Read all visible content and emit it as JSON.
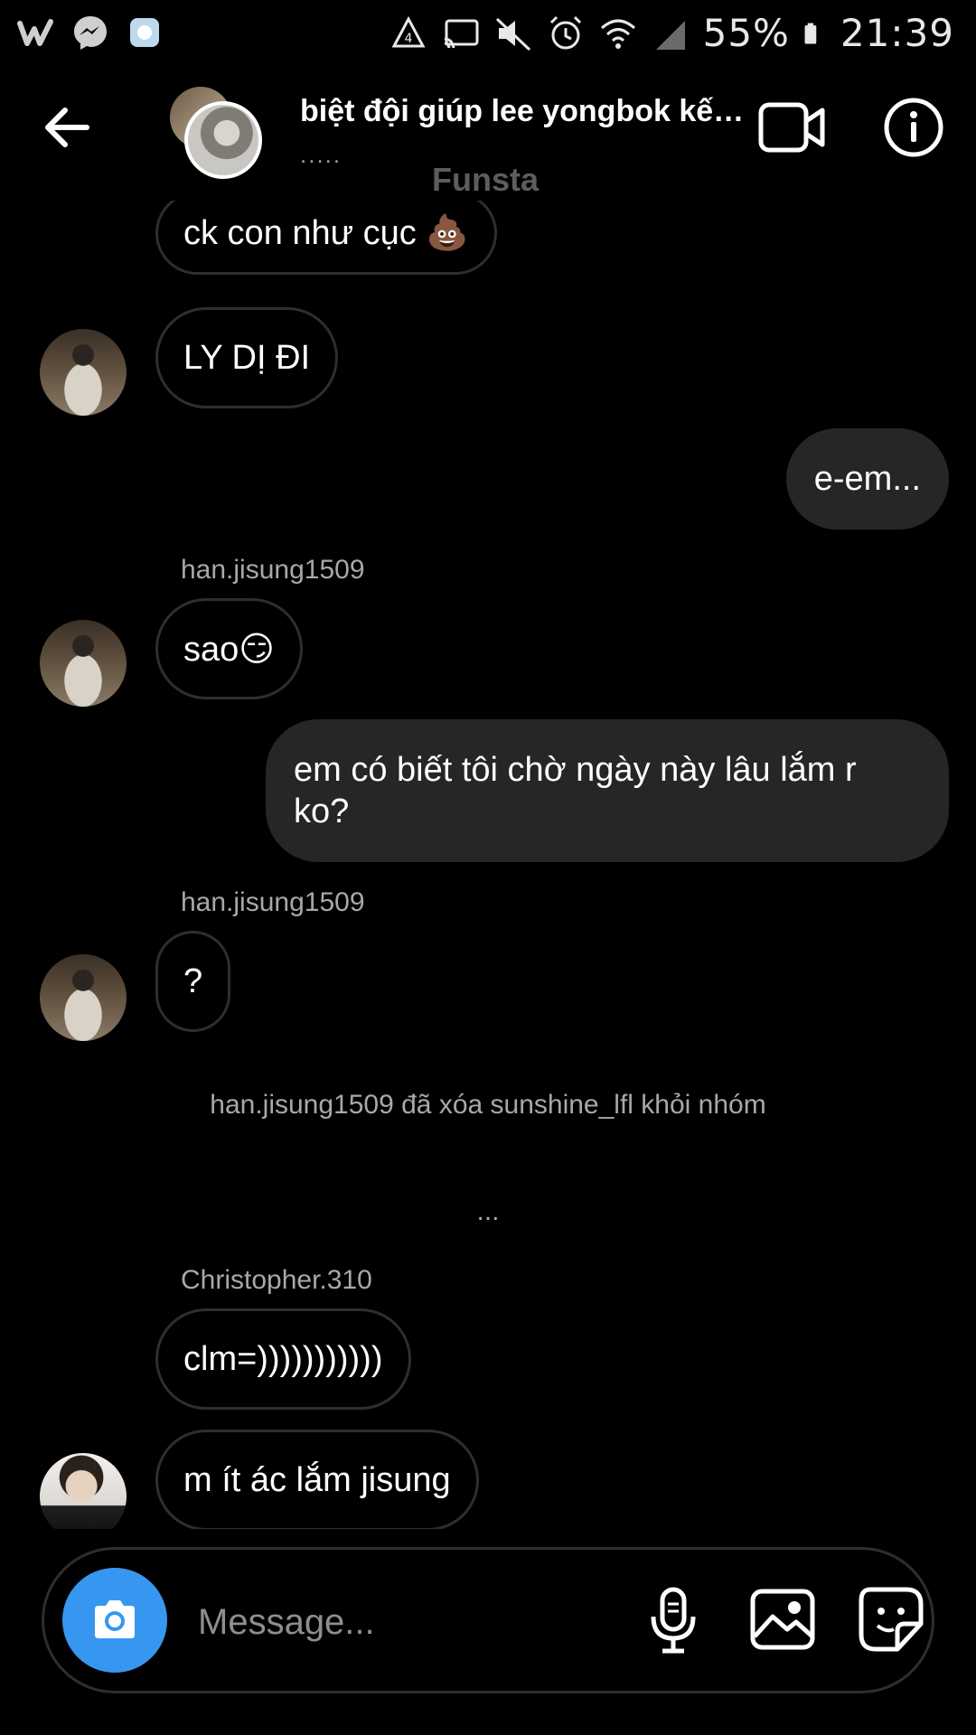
{
  "status_bar": {
    "battery": "55%",
    "time": "21:39",
    "left_icons": [
      "wattpad-icon",
      "messenger-icon",
      "app-icon"
    ],
    "right_icons": [
      "data-saver-icon",
      "cast-icon",
      "mute-icon",
      "alarm-icon",
      "wifi-icon",
      "signal-icon",
      "battery-icon"
    ]
  },
  "header": {
    "title": "biệt đội giúp lee yongbok kết ...",
    "subtitle": ".....",
    "funsta_label": "Funsta"
  },
  "messages": [
    {
      "from": "other",
      "text": "ck con như cục 💩"
    },
    {
      "from": "other",
      "text": "LY DỊ ĐI"
    },
    {
      "from": "me",
      "text": "e-em..."
    },
    {
      "from": "other",
      "sender": "han.jisung1509",
      "text": "sao😏"
    },
    {
      "from": "me",
      "text": "em có biết tôi chờ ngày này lâu lắm r ko?"
    },
    {
      "from": "other",
      "sender": "han.jisung1509",
      "text": "?"
    },
    {
      "type": "system",
      "text": "han.jisung1509 đã xóa sunshine_lfl khỏi nhóm"
    },
    {
      "type": "system",
      "text": "..."
    },
    {
      "from": "other",
      "sender": "Christopher.310",
      "text": "clm=)))))))))))"
    },
    {
      "from": "other",
      "text": "m ít ác lắm jisung"
    }
  ],
  "composer": {
    "placeholder": "Message..."
  },
  "colors": {
    "background": "#000000",
    "my_bubble": "#262626",
    "bubble_border": "#2e2e2e",
    "camera_button": "#3797f0",
    "secondary_text": "#a8a8a8"
  }
}
